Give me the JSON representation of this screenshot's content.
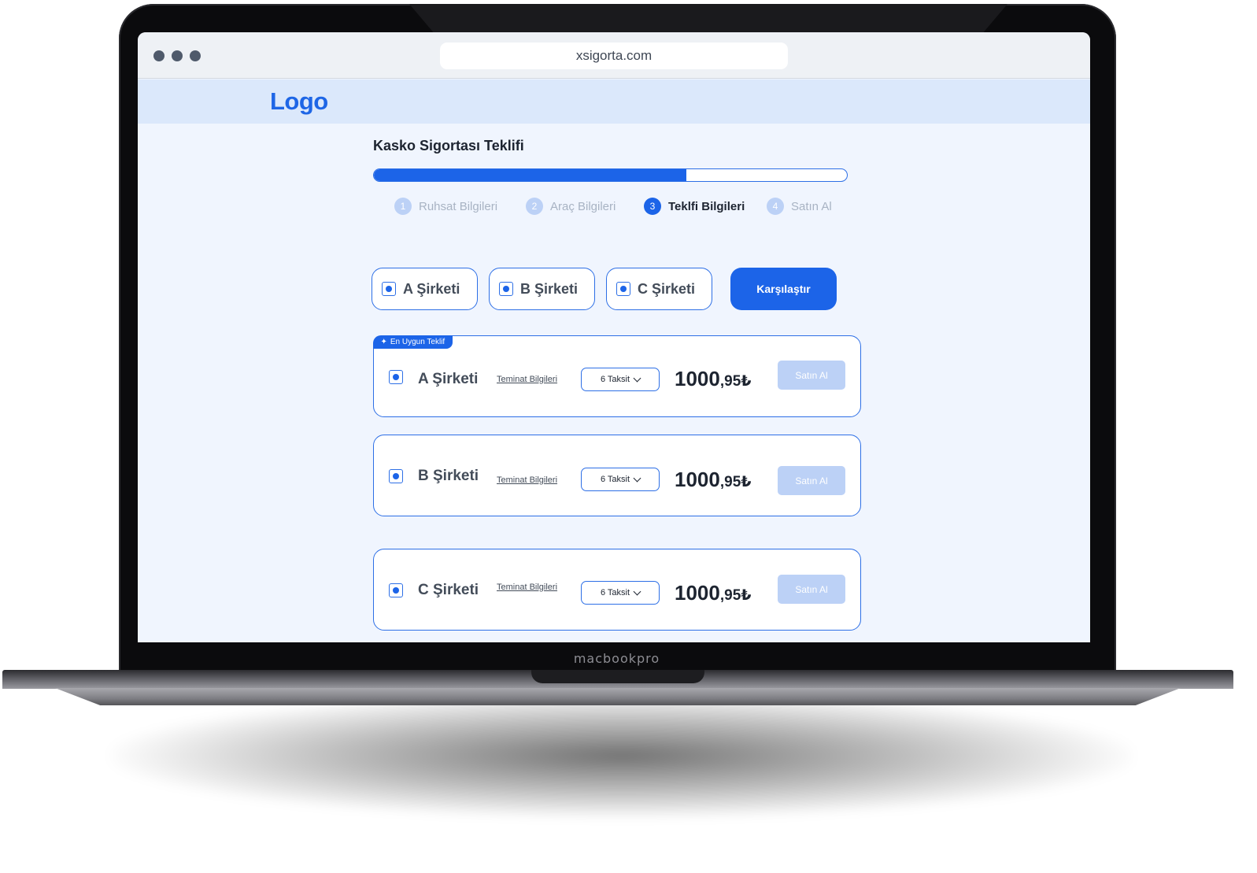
{
  "device": {
    "label": "macbookpro"
  },
  "browser": {
    "url": "xsigorta.com"
  },
  "header": {
    "logo": "Logo"
  },
  "page": {
    "title": "Kasko Sigortası Teklifi",
    "progress": 0.66
  },
  "steps": [
    {
      "number": "1",
      "label": "Ruhsat Bilgileri",
      "active": false
    },
    {
      "number": "2",
      "label": "Araç Bilgileri",
      "active": false
    },
    {
      "number": "3",
      "label": "Teklfi Bilgileri",
      "active": true
    },
    {
      "number": "4",
      "label": "Satın Al",
      "active": false
    }
  ],
  "filters": {
    "chips": [
      {
        "label": "A Şirketi",
        "checked": true
      },
      {
        "label": "B Şirketi",
        "checked": true
      },
      {
        "label": "C Şirketi",
        "checked": true
      }
    ],
    "compare_label": "Karşılaştır"
  },
  "offers": [
    {
      "badge": "En Uygun Teklif",
      "company": "A Şirketi",
      "terms_label": "Teminat Bilgileri",
      "installment": "6 Taksit",
      "price_int": "1000",
      "price_dec": ",95₺",
      "buy_label": "Satın Al"
    },
    {
      "company": "B Şirketi",
      "terms_label": "Teminat Bilgileri",
      "installment": "6 Taksit",
      "price_int": "1000",
      "price_dec": ",95₺",
      "buy_label": "Satın Al"
    },
    {
      "company": "C Şirketi",
      "terms_label": "Teminat Bilgileri",
      "installment": "6 Taksit",
      "price_int": "1000",
      "price_dec": ",95₺",
      "buy_label": "Satın Al"
    }
  ],
  "colors": {
    "primary": "#1c64e8",
    "header_bg": "#dbe8fb",
    "page_bg": "#f0f5fe",
    "disabled": "#bcd1f6"
  }
}
